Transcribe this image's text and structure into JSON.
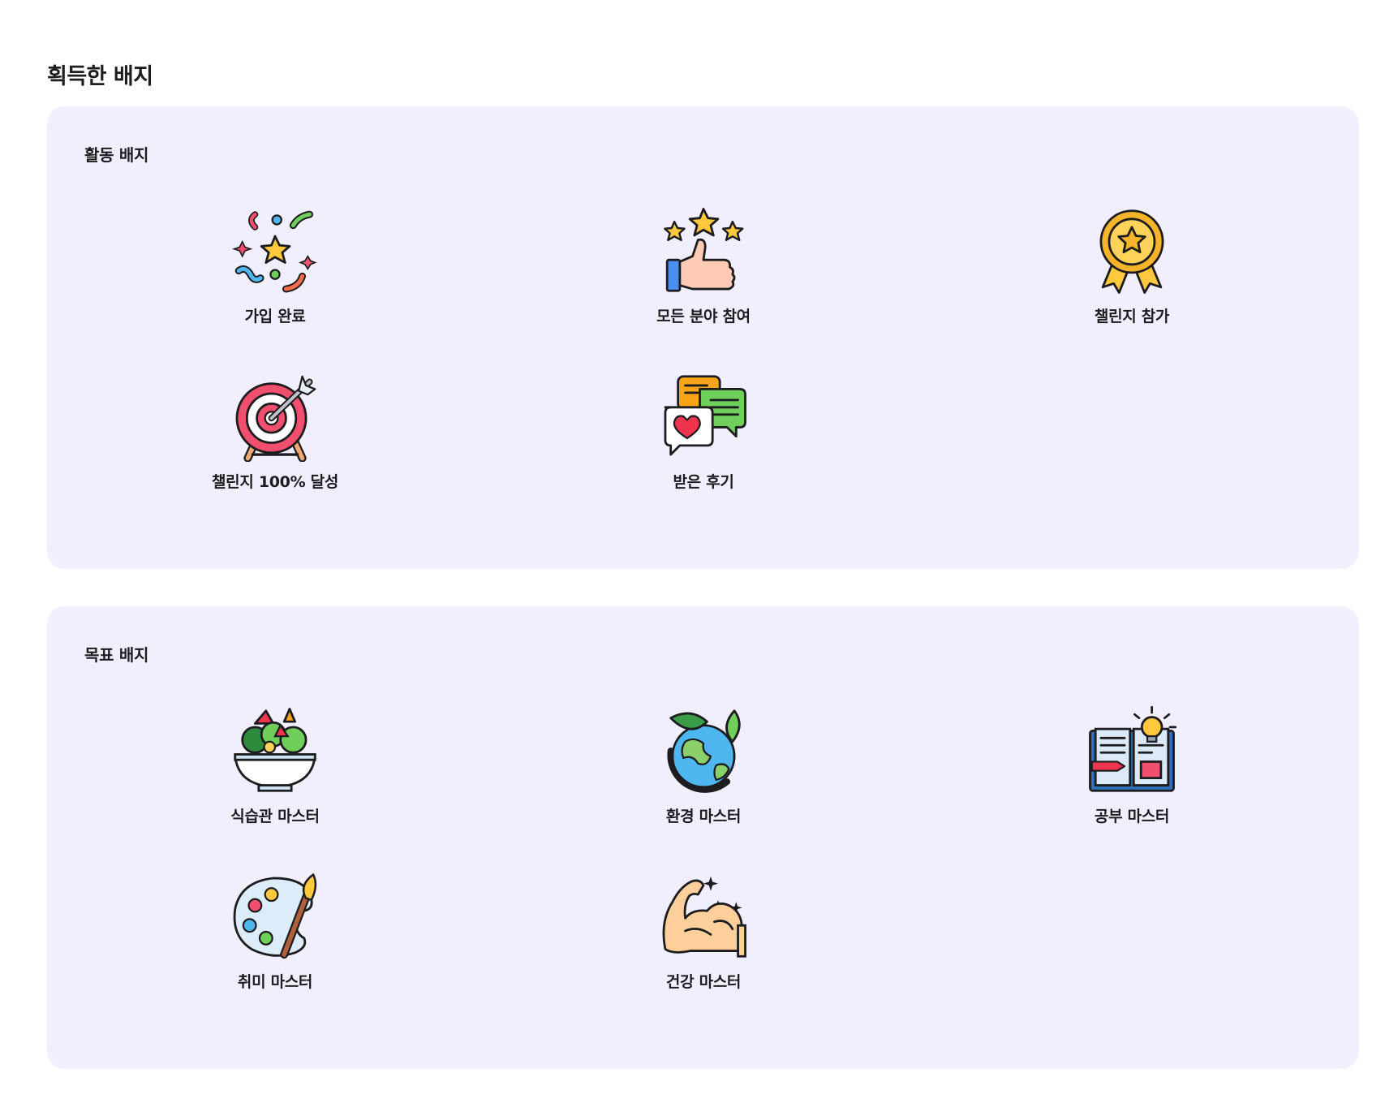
{
  "page": {
    "title": "획득한 배지"
  },
  "sections": [
    {
      "title": "활동 배지",
      "badges": [
        {
          "label": "가입 완료",
          "icon": "confetti-icon"
        },
        {
          "label": "모든 분야 참여",
          "icon": "thumbs-up-stars-icon"
        },
        {
          "label": "챌린지 참가",
          "icon": "medal-icon"
        },
        {
          "label": "챌린지 100% 달성",
          "icon": "target-arrow-icon"
        },
        {
          "label": "받은 후기",
          "icon": "chat-bubbles-heart-icon"
        }
      ]
    },
    {
      "title": "목표 배지",
      "badges": [
        {
          "label": "식습관 마스터",
          "icon": "salad-bowl-icon"
        },
        {
          "label": "환경 마스터",
          "icon": "earth-leaf-icon"
        },
        {
          "label": "공부 마스터",
          "icon": "open-book-bulb-icon"
        },
        {
          "label": "취미 마스터",
          "icon": "paint-palette-icon"
        },
        {
          "label": "건강 마스터",
          "icon": "muscle-arm-icon"
        }
      ]
    }
  ]
}
